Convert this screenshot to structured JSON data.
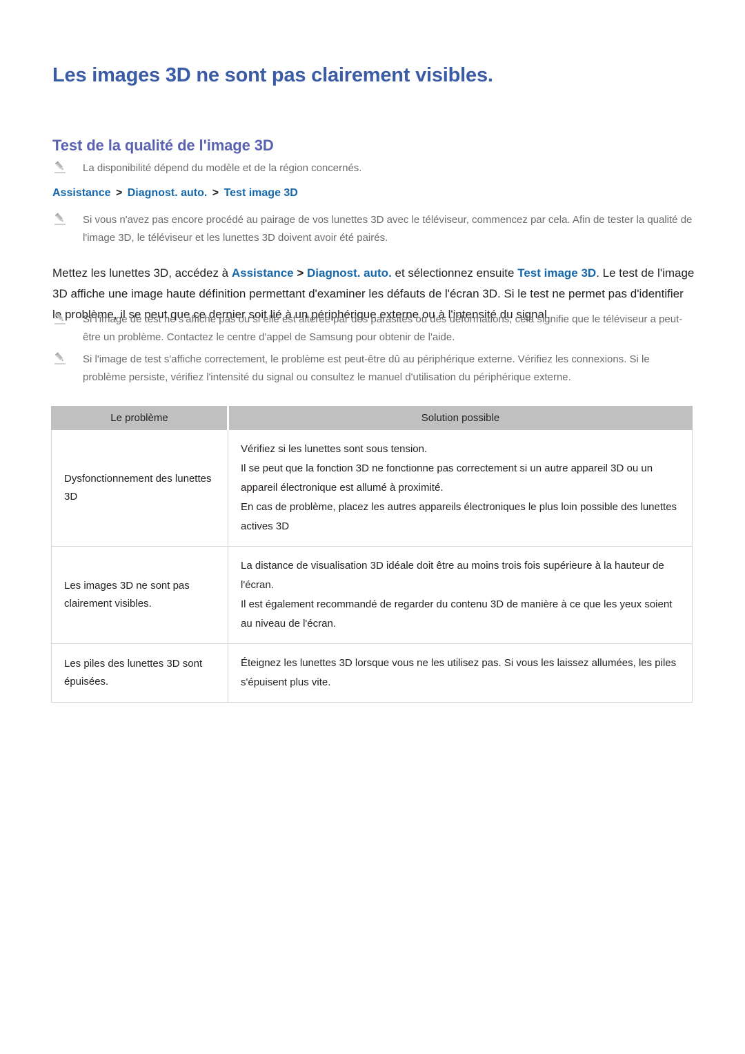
{
  "document": {
    "title": "Les images 3D ne sont pas clairement visibles.",
    "section_title": "Test de la qualité de l'image 3D"
  },
  "colors": {
    "title_blue": "#3a5ba6",
    "section_blue": "#5a62b0",
    "link_blue": "#1467ab",
    "body_text": "#231f20",
    "note_text": "#6b6b6f",
    "table_header_bg": "#c0c0c0",
    "table_border": "#d7d7d7",
    "page_bg": "#ffffff"
  },
  "notes": {
    "availability": "La disponibilité dépend du modèle et de la région concernés.",
    "pairing": "Si vous n'avez pas encore procédé au pairage de vos lunettes 3D avec le téléviseur, commencez par cela. Afin de tester la qualité de l'image 3D, le téléviseur et les lunettes 3D doivent avoir été pairés.",
    "test_fail": "Si l'image de test ne s'affiche pas ou si elle est altérée par des parasites ou des déformations, cela signifie que le téléviseur a peut-être un problème. Contactez le centre d'appel de Samsung pour obtenir de l'aide.",
    "test_ok": "Si l'image de test s'affiche correctement, le problème est peut-être dû au périphérique externe. Vérifiez les connexions. Si le problème persiste, vérifiez l'intensité du signal ou consultez le manuel d'utilisation du périphérique externe."
  },
  "breadcrumb": {
    "item1": "Assistance",
    "separator": ">",
    "item2": "Diagnost. auto.",
    "item3": "Test image 3D"
  },
  "body_paragraph": {
    "part1": "Mettez les lunettes 3D, accédez à ",
    "kw1": "Assistance",
    "sep1": " > ",
    "kw2": "Diagnost. auto.",
    "part2": " et sélectionnez ensuite ",
    "kw3": "Test image 3D",
    "part3": ". Le test de l'image 3D affiche une image haute définition permettant d'examiner les défauts de l'écran 3D. Si le test ne permet pas d'identifier le problème, il se peut que ce dernier soit lié à un périphérique externe ou à l'intensité du signal."
  },
  "table": {
    "headers": {
      "problem": "Le problème",
      "solution": "Solution possible"
    },
    "rows": [
      {
        "problem": "Dysfonctionnement des lunettes 3D",
        "solution_lines": [
          "Vérifiez si les lunettes sont sous tension.",
          "Il se peut que la fonction 3D ne fonctionne pas correctement si un autre appareil 3D ou un appareil électronique est allumé à proximité.",
          "En cas de problème, placez les autres appareils électroniques le plus loin possible des lunettes actives 3D"
        ]
      },
      {
        "problem": "Les images 3D ne sont pas clairement visibles.",
        "solution_lines": [
          "La distance de visualisation 3D idéale doit être au moins trois fois supérieure à la hauteur de l'écran.",
          "Il est également recommandé de regarder du contenu 3D de manière à ce que les yeux soient au niveau de l'écran."
        ]
      },
      {
        "problem": "Les piles des lunettes 3D sont épuisées.",
        "solution_lines": [
          "Éteignez les lunettes 3D lorsque vous ne les utilisez pas. Si vous les laissez allumées, les piles s'épuisent plus vite."
        ]
      }
    ]
  }
}
